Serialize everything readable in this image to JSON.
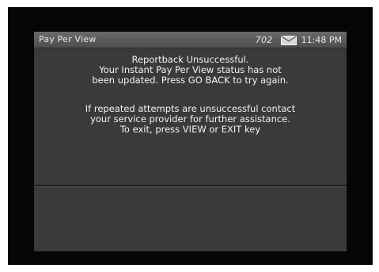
{
  "header": {
    "title": "Pay Per View",
    "channel": "702",
    "time": "11:48 PM"
  },
  "message": {
    "lines_block1": [
      "Reportback Unsuccessful.",
      "Your Instant Pay Per View status has not",
      "been updated. Press GO BACK to try again."
    ],
    "lines_block2": [
      "If repeated attempts are unsuccessful contact",
      "your service provider for further assistance.",
      "To exit, press VIEW or EXIT key"
    ]
  },
  "icons": {
    "mail": "mail-icon"
  }
}
